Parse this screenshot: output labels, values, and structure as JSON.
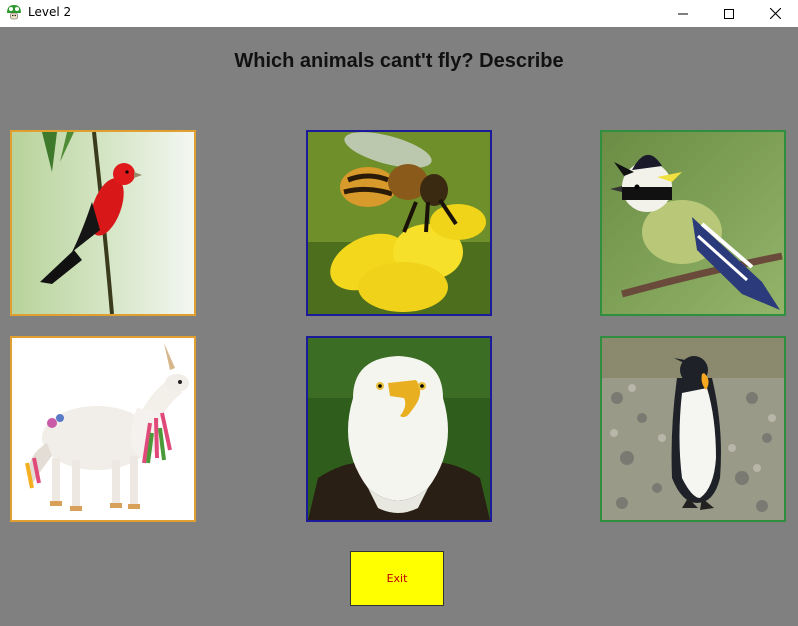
{
  "window": {
    "title": "Level 2",
    "icon": "mushroom-icon",
    "controls": [
      "minimize-icon",
      "maximize-icon",
      "close-icon"
    ]
  },
  "question": "Which animals cant't fly? Describe",
  "cards": [
    {
      "animal": "scarlet tanager bird",
      "border_color": "#e0a030"
    },
    {
      "animal": "honey bee on yellow flower",
      "border_color": "#1a1a9a"
    },
    {
      "animal": "crested tit bird",
      "border_color": "#2f8f3f"
    },
    {
      "animal": "unicorn figurine",
      "border_color": "#e0a030"
    },
    {
      "animal": "bald eagle",
      "border_color": "#1a1a9a"
    },
    {
      "animal": "king penguin",
      "border_color": "#2f8f3f"
    }
  ],
  "exit_button": {
    "label": "Exit",
    "background": "#ffff00",
    "text_color": "#c00000"
  },
  "colors": {
    "background": "#808080"
  }
}
